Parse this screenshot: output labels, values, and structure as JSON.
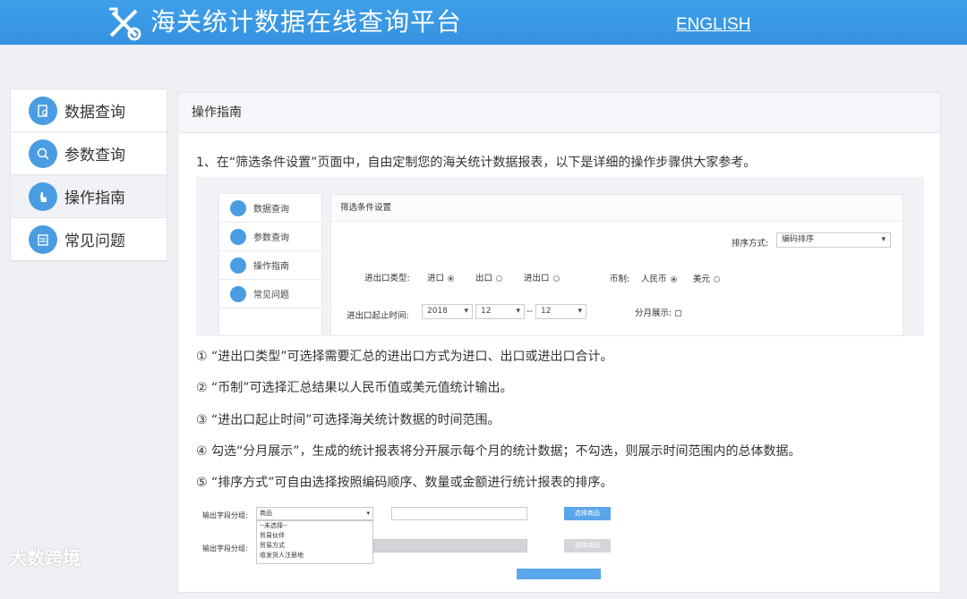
{
  "header": {
    "title": "海关统计数据在线查询平台",
    "english": "ENGLISH"
  },
  "sidebar": {
    "items": [
      {
        "label": "数据查询",
        "icon": "document-search-icon"
      },
      {
        "label": "参数查询",
        "icon": "magnifier-icon"
      },
      {
        "label": "操作指南",
        "icon": "hand-pointer-icon",
        "active": true
      },
      {
        "label": "常见问题",
        "icon": "clipboard-icon"
      }
    ]
  },
  "panel": {
    "title": "操作指南",
    "intro": "1、在“筛选条件设置”页面中，自由定制您的海关统计数据报表，以下是详细的操作步骤供大家参考。"
  },
  "shot1": {
    "side": [
      "数据查询",
      "参数查询",
      "操作指南",
      "常见问题"
    ],
    "title": "筛选条件设置",
    "sort_label": "排序方式:",
    "sort_value": "编码排序",
    "type_label": "进出口类型:",
    "type_options": [
      "进口",
      "出口",
      "进出口"
    ],
    "currency_label": "币制:",
    "currency_options": [
      "人民币",
      "美元"
    ],
    "time_label": "进出口起止时间:",
    "year": "2018",
    "month_from": "12",
    "dash": "--",
    "month_to": "12",
    "monthly_label": "分月展示:"
  },
  "notes": [
    "①  “进出口类型”可选择需要汇总的进出口方式为进口、出口或进出口合计。",
    "②  “币制”可选择汇总结果以人民币值或美元值统计输出。",
    "③  “进出口起止时间”可选择海关统计数据的时间范围。",
    "④ 勾选“分月展示”，生成的统计报表将分开展示每个月的统计数据；不勾选，则展示时间范围内的总体数据。",
    "⑤  “排序方式”可自由选择按照编码顺序、数量或金额进行统计报表的排序。"
  ],
  "shot2": {
    "row1_label": "输出字段分组:",
    "row1_value": "商品",
    "options": [
      "--未选择--",
      "贸易伙伴",
      "贸易方式",
      "收发货人注册地"
    ],
    "row2_label": "输出字段分组:",
    "btn1": "选择商品",
    "btn2": "选择商品"
  },
  "watermark": "大数跨境"
}
